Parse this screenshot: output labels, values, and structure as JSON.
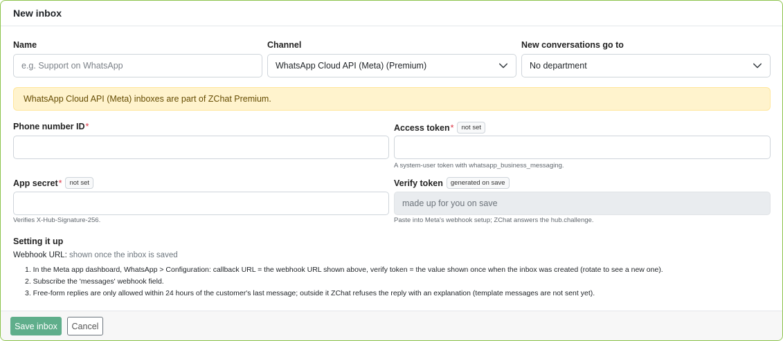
{
  "header": {
    "title": "New inbox"
  },
  "form": {
    "name": {
      "label": "Name",
      "placeholder": "e.g. Support on WhatsApp",
      "value": ""
    },
    "channel": {
      "label": "Channel",
      "value": "WhatsApp Cloud API (Meta) (Premium)"
    },
    "department": {
      "label": "New conversations go to",
      "value": "No department"
    },
    "premium_alert": "WhatsApp Cloud API (Meta) inboxes are part of ZChat Premium.",
    "phone_number_id": {
      "label": "Phone number ID",
      "required": "*",
      "value": ""
    },
    "access_token": {
      "label": "Access token",
      "required": "*",
      "badge": "not set",
      "help": "A system-user token with whatsapp_business_messaging.",
      "value": ""
    },
    "app_secret": {
      "label": "App secret",
      "required": "*",
      "badge": "not set",
      "help": "Verifies X-Hub-Signature-256.",
      "value": ""
    },
    "verify_token": {
      "label": "Verify token",
      "badge": "generated on save",
      "placeholder": "made up for you on save",
      "help": "Paste into Meta's webhook setup; ZChat answers the hub.challenge."
    }
  },
  "setup": {
    "title": "Setting it up",
    "webhook_label": "Webhook URL:",
    "webhook_value": "shown once the inbox is saved",
    "steps": [
      "1. In the Meta app dashboard, WhatsApp > Configuration: callback URL = the webhook URL shown above, verify token = the value shown once when the inbox was created (rotate to see a new one).",
      "2. Subscribe the 'messages' webhook field.",
      "3. Free-form replies are only allowed within 24 hours of the customer's last message; outside it ZChat refuses the reply with an explanation (template messages are not sent yet)."
    ]
  },
  "footer": {
    "save_label": "Save inbox",
    "cancel_label": "Cancel"
  },
  "icons": {
    "select_arrow": "chevron-down-icon"
  },
  "colors": {
    "accent": "#5fae8b",
    "alert_bg": "#fff3cd",
    "required": "#dc3545",
    "card_border": "#8bc34a"
  }
}
